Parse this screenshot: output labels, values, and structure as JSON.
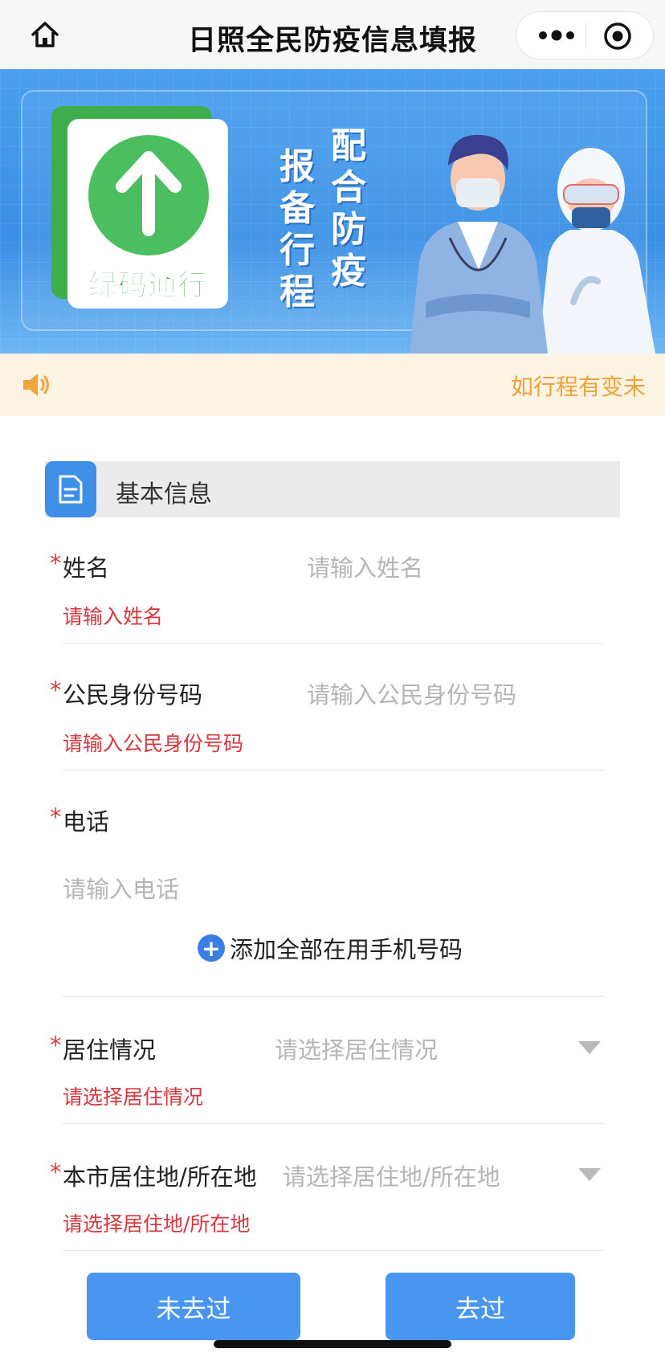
{
  "header": {
    "title": "日照全民防疫信息填报"
  },
  "banner": {
    "green_card_label": "绿码通行",
    "slogan_left": [
      "报",
      "备",
      "行",
      "程"
    ],
    "slogan_right": [
      "配",
      "合",
      "防",
      "疫"
    ]
  },
  "notice": {
    "text": "如行程有变未"
  },
  "section": {
    "title": "基本信息"
  },
  "form": {
    "name": {
      "required": "*",
      "label": "姓名",
      "placeholder": "请输入姓名",
      "error": "请输入姓名"
    },
    "id_number": {
      "required": "*",
      "label": "公民身份号码",
      "placeholder": "请输入公民身份号码",
      "error": "请输入公民身份号码"
    },
    "phone": {
      "required": "*",
      "label": "电话",
      "placeholder": "请输入电话",
      "add_label": "添加全部在用手机号码"
    },
    "residence_status": {
      "required": "*",
      "label": "居住情况",
      "placeholder": "请选择居住情况",
      "error": "请选择居住情况"
    },
    "residence_location": {
      "required": "*",
      "label": "本市居住地/所在地",
      "placeholder": "请选择居住地/所在地",
      "error": "请选择居住地/所在地"
    }
  },
  "buttons": {
    "not_been": "未去过",
    "been": "去过"
  },
  "colors": {
    "primary": "#4896f0",
    "error": "#d9363e",
    "notice": "#f0a23a",
    "green": "#4bbf5f"
  }
}
